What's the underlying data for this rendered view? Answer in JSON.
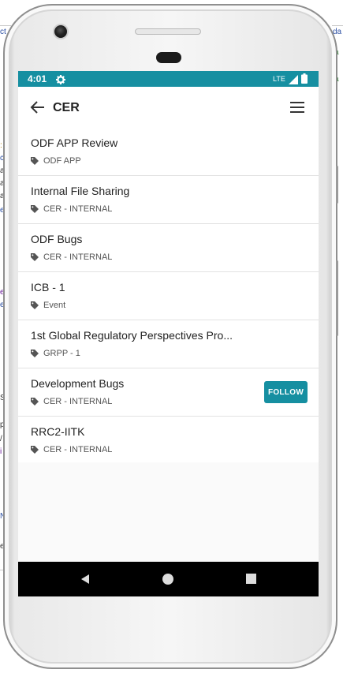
{
  "status_bar": {
    "time": "4:01",
    "network": "LTE",
    "color": "#168fa1"
  },
  "app_bar": {
    "title": "CER"
  },
  "items": [
    {
      "title": "ODF APP Review",
      "tag": "ODF APP"
    },
    {
      "title": "Internal File Sharing",
      "tag": "CER - INTERNAL"
    },
    {
      "title": "ODF Bugs",
      "tag": "CER - INTERNAL"
    },
    {
      "title": "ICB - 1",
      "tag": "Event"
    },
    {
      "title": "1st Global Regulatory Perspectives Pro...",
      "tag": "GRPP - 1"
    },
    {
      "title": "Development Bugs",
      "tag": "CER - INTERNAL",
      "follow_label": "FOLLOW"
    },
    {
      "title": "RRC2-IITK",
      "tag": "CER - INTERNAL"
    }
  ],
  "icons": {
    "back": "arrow-left-icon",
    "menu": "hamburger-icon",
    "tag": "tag-icon",
    "settings": "gear-icon"
  },
  "accent_color": "#168fa1"
}
